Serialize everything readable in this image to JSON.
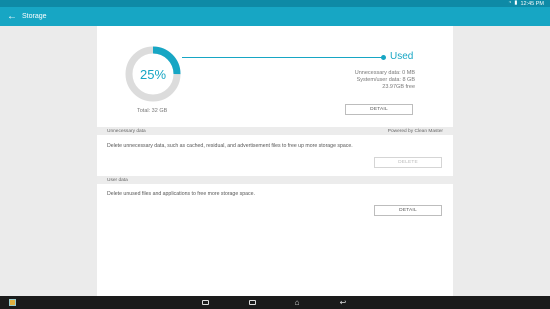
{
  "status_bar": {
    "time": "12:45 PM"
  },
  "app_bar": {
    "title": "Storage"
  },
  "storage": {
    "percent_label": "25%",
    "percent_used": 25,
    "used_label": "Used",
    "unnecessary_line": "Unnecessary data: 0 MB",
    "system_line": "System/user data: 8 GB",
    "free_line": "23.97GB free",
    "total_label": "Total: 32 GB",
    "detail_button": "DETAIL"
  },
  "unnecessary_section": {
    "header": "Unnecessary data",
    "powered_by": "Powered by Clean Master",
    "description": "Delete unnecessary data, such as cached, residual, and advertisement files to free up more storage space.",
    "delete_button": "DELETE"
  },
  "user_section": {
    "header": "User data",
    "description": "Delete unused files and applications to free more storage space.",
    "detail_button": "DETAIL"
  },
  "colors": {
    "accent": "#17a6c4",
    "status_bar": "#0e8aa6",
    "ring_track": "#dcdcdc"
  }
}
